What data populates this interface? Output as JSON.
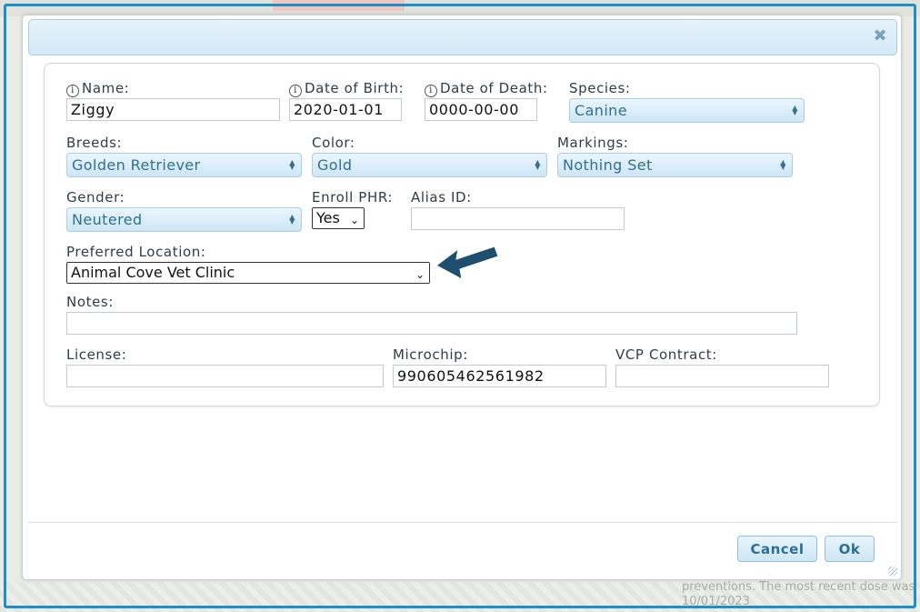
{
  "dialog": {
    "close_icon": "close-icon",
    "cancel_label": "Cancel",
    "ok_label": "Ok"
  },
  "form": {
    "name": {
      "label": "Name:",
      "value": "Ziggy"
    },
    "dob": {
      "label": "Date of Birth:",
      "value": "2020-01-01"
    },
    "dod": {
      "label": "Date of Death:",
      "value": "0000-00-00"
    },
    "species": {
      "label": "Species:",
      "value": "Canine"
    },
    "breeds": {
      "label": "Breeds:",
      "value": "Golden Retriever"
    },
    "color": {
      "label": "Color:",
      "value": "Gold"
    },
    "markings": {
      "label": "Markings:",
      "value": "Nothing Set"
    },
    "gender": {
      "label": "Gender:",
      "value": "Neutered"
    },
    "enroll_phr": {
      "label": "Enroll PHR:",
      "value": "Yes"
    },
    "alias_id": {
      "label": "Alias ID:",
      "value": ""
    },
    "preferred_location": {
      "label": "Preferred Location:",
      "value": "Animal Cove Vet Clinic"
    },
    "notes": {
      "label": "Notes:",
      "value": ""
    },
    "license": {
      "label": "License:",
      "value": ""
    },
    "microchip": {
      "label": "Microchip:",
      "value": "990605462561982"
    },
    "vcp_contract": {
      "label": "VCP Contract:",
      "value": ""
    }
  },
  "background": {
    "bottom_text_line1": "preventions. The most recent dose was",
    "bottom_text_line2": "10/01/2023"
  },
  "colors": {
    "frame_blue": "#1e8fc6",
    "arrow_navy": "#1f4f6e",
    "button_text": "#2b6f97"
  }
}
